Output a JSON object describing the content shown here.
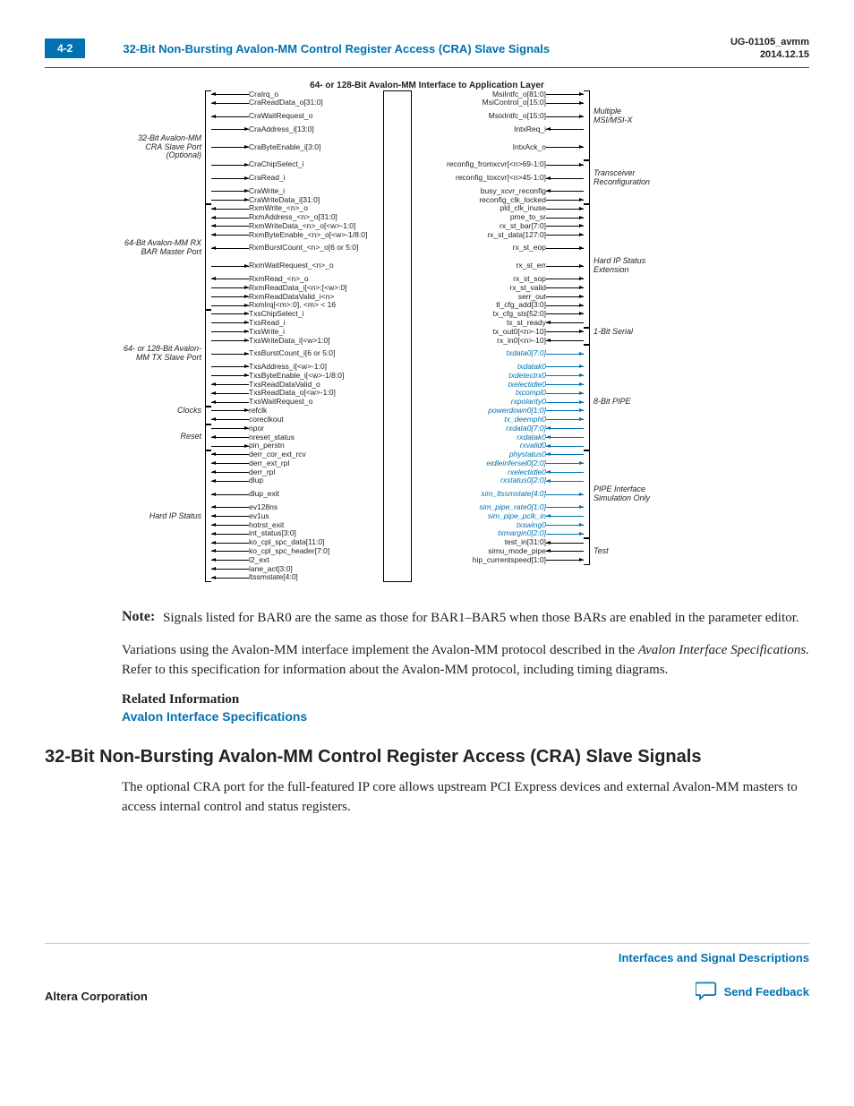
{
  "header": {
    "page_num": "4-2",
    "title": "32-Bit Non-Bursting Avalon-MM Control Register Access (CRA) Slave Signals",
    "doc_id": "UG-01105_avmm",
    "date": "2014.12.15"
  },
  "diagram": {
    "title": "64- or 128-Bit Avalon-MM Interface to Application Layer",
    "left_groups": [
      {
        "label": "32-Bit\nAvalon-MM\nCRA\nSlave Port\n(Optional)",
        "signals": [
          "CraIrq_o",
          "CraReadData_o[31:0]",
          "CraWaitRequest_o",
          "CraAddress_i[13:0]",
          "CraByteEnable_i[3:0]",
          "CraChipSelect_i",
          "CraRead_i",
          "CraWrite_i",
          "CraWriteData_i[31:0]"
        ],
        "dirs": [
          "l",
          "l",
          "l",
          "r",
          "r",
          "r",
          "r",
          "r",
          "r"
        ]
      },
      {
        "label": "64-Bit\nAvalon-MM RX BAR\nMaster Port",
        "signals": [
          "RxmWrite_<n>_o",
          "RxmAddress_<n>_o[31:0]",
          "RxmWriteData_<n>_o[<w>-1:0]",
          "RxmByteEnable_<n>_o[<w>-1/8:0]",
          "RxmBurstCount_<n>_o[6 or 5:0]",
          "RxmWaitRequest_<n>_o",
          "RxmRead_<n>_o",
          "RxmReadData_i[<n>:[<w>:0]",
          "RxmReadDataValid_i<n>",
          "RxmIrq[<m>:0], <m> < 16"
        ],
        "dirs": [
          "l",
          "l",
          "l",
          "l",
          "l",
          "r",
          "l",
          "r",
          "r",
          "r"
        ]
      },
      {
        "label": "64- or 128-Bit\nAvalon-MM TX\nSlave Port",
        "signals": [
          "TxsChipSelect_i",
          "TxsRead_i",
          "TxsWrite_i",
          "TxsWriteData_i[<w>1:0]",
          "TxsBurstCount_i[6 or 5:0]",
          "TxsAddress_i[<w>-1:0]",
          "TxsByteEnable_i[<w>-1/8:0]",
          "TxsReadDataValid_o",
          "TxsReadData_o[<w>-1:0]",
          "TxsWaitRequest_o"
        ],
        "dirs": [
          "r",
          "r",
          "r",
          "r",
          "r",
          "r",
          "r",
          "l",
          "l",
          "l"
        ]
      },
      {
        "label": "Clocks",
        "signals": [
          "refclk",
          "coreclkout"
        ],
        "dirs": [
          "r",
          "l"
        ]
      },
      {
        "label": "Reset",
        "signals": [
          "npor",
          "nreset_status",
          "pin_perstn"
        ],
        "dirs": [
          "r",
          "l",
          "r"
        ]
      },
      {
        "label": "Hard IP\nStatus",
        "signals": [
          "derr_cor_ext_rcv",
          "derr_ext_rpl",
          "derr_rpl",
          "dlup",
          "dlup_exit",
          "ev128ns",
          "ev1us",
          "hotrst_exit",
          "int_status[3:0]",
          "ko_cpl_spc_data[11:0]",
          "ko_cpl_spc_header[7:0]",
          "l2_ext",
          "lane_act[3:0]",
          "ltssmstate[4:0]"
        ],
        "dirs": [
          "l",
          "l",
          "l",
          "l",
          "l",
          "l",
          "l",
          "l",
          "l",
          "l",
          "l",
          "l",
          "l",
          "l"
        ]
      }
    ],
    "right_groups": [
      {
        "label": "Multiple\nMSI/MSI-X",
        "signals": [
          "MsiIntfc_o[81:0]",
          "MsiControl_o[15:0]",
          "MsixIntfc_o[15:0]",
          "IntxReq_i",
          "IntxAck_o"
        ],
        "dirs": [
          "r",
          "r",
          "r",
          "l",
          "r"
        ]
      },
      {
        "label": "Transceiver\nReconfiguration",
        "signals": [
          "reconfig_fromxcvr[<n>69-1:0]",
          "reconfig_toxcvr[<n>45-1:0]",
          "busy_xcvr_reconfig",
          "reconfig_clk_locked"
        ],
        "dirs": [
          "r",
          "l",
          "l",
          "r"
        ]
      },
      {
        "label": "Hard IP\nStatus\nExtension",
        "signals": [
          "pld_clk_inuse",
          "pme_to_sr",
          "rx_st_bar[7:0]",
          "rx_st_data[127:0]",
          "rx_st_eop",
          "rx_st_err",
          "rx_st_sop",
          "rx_st_valid",
          "serr_out",
          "tl_cfg_add[3:0]",
          "tx_cfg_sts[52:0]",
          "tx_st_ready"
        ],
        "dirs": [
          "r",
          "r",
          "r",
          "r",
          "r",
          "r",
          "r",
          "r",
          "r",
          "r",
          "r",
          "l"
        ]
      },
      {
        "label": "1-Bit Serial",
        "signals": [
          "tx_out0[<n>-10]",
          "rx_in0[<n>-10]"
        ],
        "dirs": [
          "r",
          "l"
        ]
      },
      {
        "label": "8-Bit PIPE",
        "signals": [
          "txdata0[7:0]",
          "txdatak0",
          "txdetectrx0",
          "txelectidle0",
          "txcompl0",
          "rxpolarity0",
          "powerdown0[1:0]",
          "tx_deemph0",
          "rxdata0[7:0]",
          "rxdatak0",
          "rxvalid0"
        ],
        "blue": true,
        "dirs": [
          "r",
          "r",
          "r",
          "r",
          "r",
          "r",
          "r",
          "r",
          "l",
          "l",
          "l"
        ]
      },
      {
        "label": "PIPE Interface\nSimulation Only",
        "signals": [
          "phystatus0",
          "eidleinfersel0[2:0]",
          "rxelectidle0",
          "rxstatus0[2:0]",
          "sim_ltssmstate[4:0]",
          "sim_pipe_rate0[1:0]",
          "sim_pipe_pclk_in",
          "txswing0",
          "txmargin0[2:0]"
        ],
        "blue": true,
        "dirs": [
          "l",
          "r",
          "l",
          "l",
          "r",
          "r",
          "l",
          "r",
          "r"
        ],
        "label_pos": "below"
      },
      {
        "label": "Test",
        "signals": [
          "test_in[31:0]",
          "simu_mode_pipe",
          "hip_currentspeed[1:0]"
        ],
        "dirs": [
          "l",
          "l",
          "r"
        ]
      }
    ]
  },
  "note": {
    "label": "Note:",
    "text": "Signals listed for BAR0 are the same as those for BAR1–BAR5 when those BARs are enabled in the parameter editor."
  },
  "para1_a": "Variations using the Avalon-MM interface implement the Avalon-MM protocol described in the ",
  "para1_i": "Avalon Interface Specifications.",
  "para1_b": " Refer to this specification for information about the Avalon-MM protocol, including timing diagrams.",
  "rel_info_h": "Related Information",
  "rel_info_link": "Avalon Interface Specifications",
  "h2": "32-Bit Non-Bursting Avalon-MM Control Register Access (CRA) Slave Signals",
  "para2": "The optional CRA port for the full-featured IP core allows upstream PCI Express devices and external Avalon‑MM masters to access internal control and status registers.",
  "footer": {
    "left": "Altera Corporation",
    "right_link": "Interfaces and Signal Descriptions",
    "feedback": "Send Feedback"
  }
}
